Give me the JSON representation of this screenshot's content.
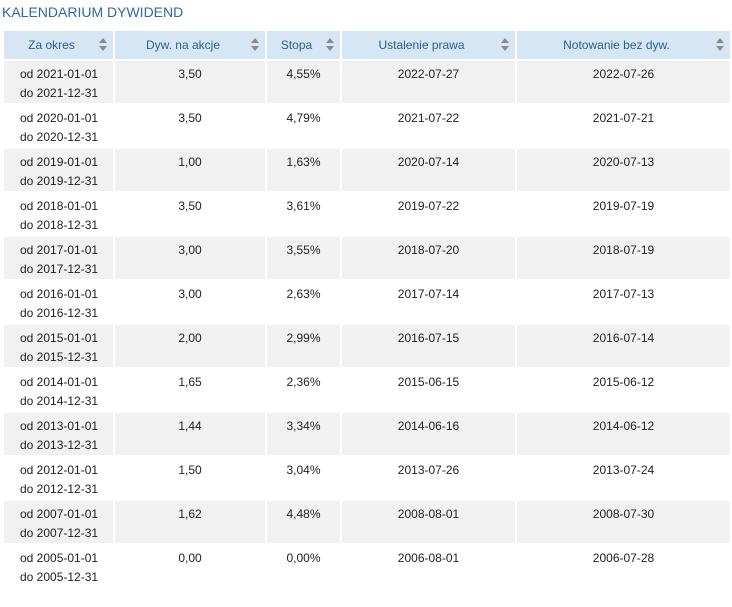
{
  "title": "KALENDARIUM DYWIDEND",
  "columns": [
    "Za okres",
    "Dyw. na akcje",
    "Stopa",
    "Ustalenie prawa",
    "Notowanie bez dyw."
  ],
  "rows": [
    {
      "from": "od 2021-01-01",
      "to": "do 2021-12-31",
      "dividend": "3,50",
      "rate": "4,55%",
      "record_date": "2022-07-27",
      "ex_date": "2022-07-26"
    },
    {
      "from": "od 2020-01-01",
      "to": "do 2020-12-31",
      "dividend": "3,50",
      "rate": "4,79%",
      "record_date": "2021-07-22",
      "ex_date": "2021-07-21"
    },
    {
      "from": "od 2019-01-01",
      "to": "do 2019-12-31",
      "dividend": "1,00",
      "rate": "1,63%",
      "record_date": "2020-07-14",
      "ex_date": "2020-07-13"
    },
    {
      "from": "od 2018-01-01",
      "to": "do 2018-12-31",
      "dividend": "3,50",
      "rate": "3,61%",
      "record_date": "2019-07-22",
      "ex_date": "2019-07-19"
    },
    {
      "from": "od 2017-01-01",
      "to": "do 2017-12-31",
      "dividend": "3,00",
      "rate": "3,55%",
      "record_date": "2018-07-20",
      "ex_date": "2018-07-19"
    },
    {
      "from": "od 2016-01-01",
      "to": "do 2016-12-31",
      "dividend": "3,00",
      "rate": "2,63%",
      "record_date": "2017-07-14",
      "ex_date": "2017-07-13"
    },
    {
      "from": "od 2015-01-01",
      "to": "do 2015-12-31",
      "dividend": "2,00",
      "rate": "2,99%",
      "record_date": "2016-07-15",
      "ex_date": "2016-07-14"
    },
    {
      "from": "od 2014-01-01",
      "to": "do 2014-12-31",
      "dividend": "1,65",
      "rate": "2,36%",
      "record_date": "2015-06-15",
      "ex_date": "2015-06-12"
    },
    {
      "from": "od 2013-01-01",
      "to": "do 2013-12-31",
      "dividend": "1,44",
      "rate": "3,34%",
      "record_date": "2014-06-16",
      "ex_date": "2014-06-12"
    },
    {
      "from": "od 2012-01-01",
      "to": "do 2012-12-31",
      "dividend": "1,50",
      "rate": "3,04%",
      "record_date": "2013-07-26",
      "ex_date": "2013-07-24"
    },
    {
      "from": "od 2007-01-01",
      "to": "do 2007-12-31",
      "dividend": "1,62",
      "rate": "4,48%",
      "record_date": "2008-08-01",
      "ex_date": "2008-07-30"
    },
    {
      "from": "od 2005-01-01",
      "to": "do 2005-12-31",
      "dividend": "0,00",
      "rate": "0,00%",
      "record_date": "2006-08-01",
      "ex_date": "2006-07-28"
    }
  ],
  "colors": {
    "title": "#2e6c99",
    "header_bg": "#d6e6f4",
    "header_text": "#2f5f8a",
    "row_alt_bg": "#f1f1f1"
  }
}
